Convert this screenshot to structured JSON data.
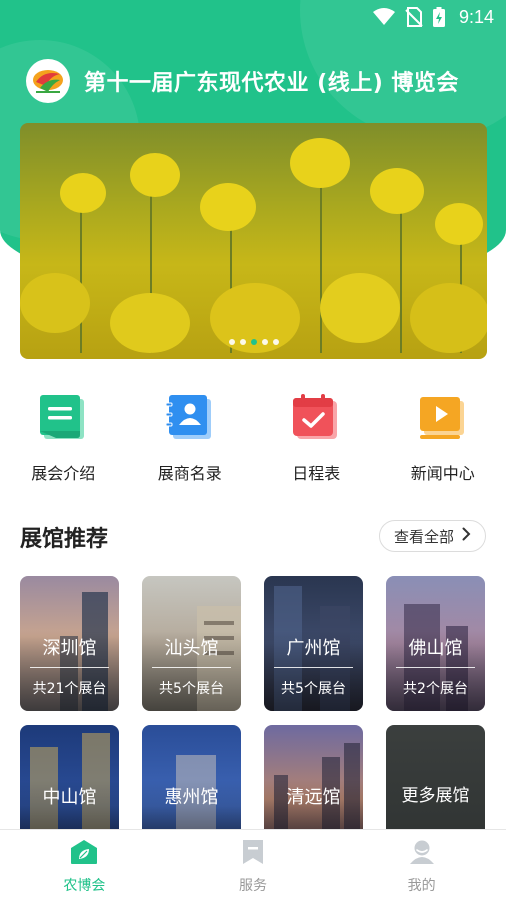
{
  "status_bar": {
    "time": "9:14"
  },
  "app_title": "第十一届广东现代农业 (线上) 博览会",
  "banner": {
    "slide_count": 5,
    "active_slide": 3
  },
  "quick_nav": [
    {
      "label": "展会介绍",
      "icon": "document-icon",
      "color": "#21c28a"
    },
    {
      "label": "展商名录",
      "icon": "contact-book-icon",
      "color": "#2f8ff0"
    },
    {
      "label": "日程表",
      "icon": "calendar-check-icon",
      "color": "#f0525a"
    },
    {
      "label": "新闻中心",
      "icon": "video-play-icon",
      "color": "#f5a623"
    }
  ],
  "section": {
    "title": "展馆推荐",
    "view_all": "查看全部"
  },
  "halls": [
    {
      "name": "深圳馆",
      "count": "共21个展台"
    },
    {
      "name": "汕头馆",
      "count": "共5个展台"
    },
    {
      "name": "广州馆",
      "count": "共5个展台"
    },
    {
      "name": "佛山馆",
      "count": "共2个展台"
    },
    {
      "name": "中山馆",
      "count": ""
    },
    {
      "name": "惠州馆",
      "count": ""
    },
    {
      "name": "清远馆",
      "count": ""
    },
    {
      "name": "更多展馆",
      "count": ""
    }
  ],
  "tabs": [
    {
      "label": "农博会",
      "icon": "leaf-home-icon",
      "active": true
    },
    {
      "label": "服务",
      "icon": "bookmark-icon",
      "active": false
    },
    {
      "label": "我的",
      "icon": "user-icon",
      "active": false
    }
  ],
  "colors": {
    "brand": "#21c28a"
  }
}
